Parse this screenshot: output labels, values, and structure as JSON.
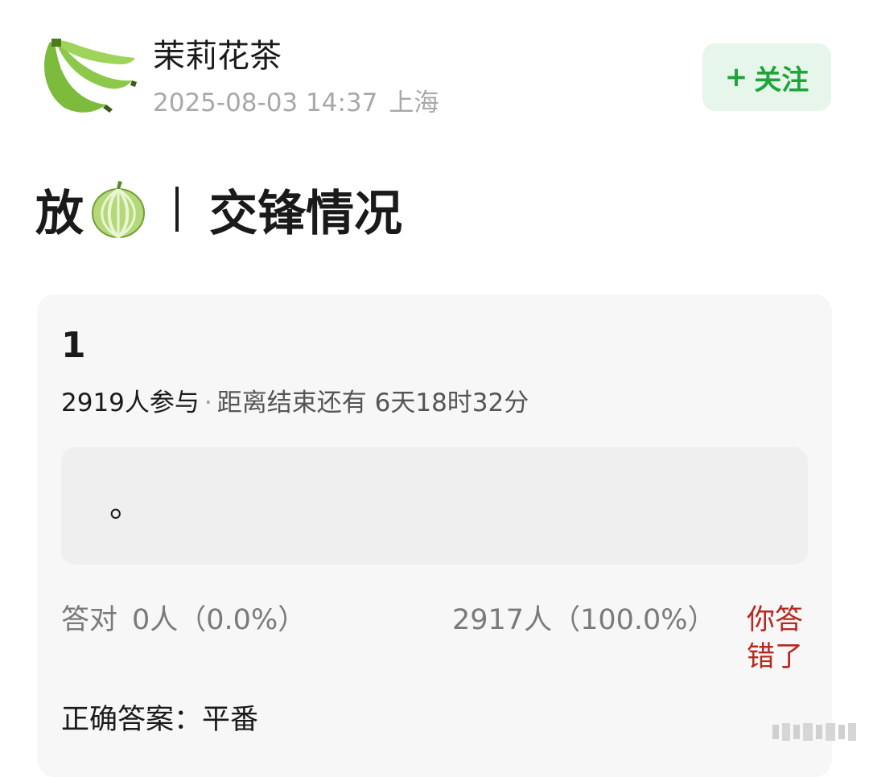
{
  "author": {
    "name": "茉莉花茶",
    "date": "2025-08-03 14:37",
    "location": "上海",
    "avatar_icon": "banana-bunch-avatar"
  },
  "follow_button": {
    "plus": "+",
    "label": "关注"
  },
  "post": {
    "title_prefix": "放",
    "title_emoji": "melon-icon",
    "title_main": "交锋情况"
  },
  "quiz": {
    "number": "1",
    "participants": "2919人参与",
    "separator": "·",
    "remaining": "距离结束还有 6天18时32分",
    "option_text": "。",
    "correct_label": "答对",
    "correct_stats": "0人（0.0%）",
    "wrong_stats": "2917人（100.0%）",
    "wrong_badge": "你答错了",
    "answer": "正确答案：平番"
  },
  "colors": {
    "accent_green": "#21a33c",
    "follow_bg": "#e6f6ea",
    "wrong_red": "#b8281f",
    "card_bg": "#f7f7f7",
    "option_bg": "#efefef",
    "muted_text": "#a8a8a8"
  }
}
